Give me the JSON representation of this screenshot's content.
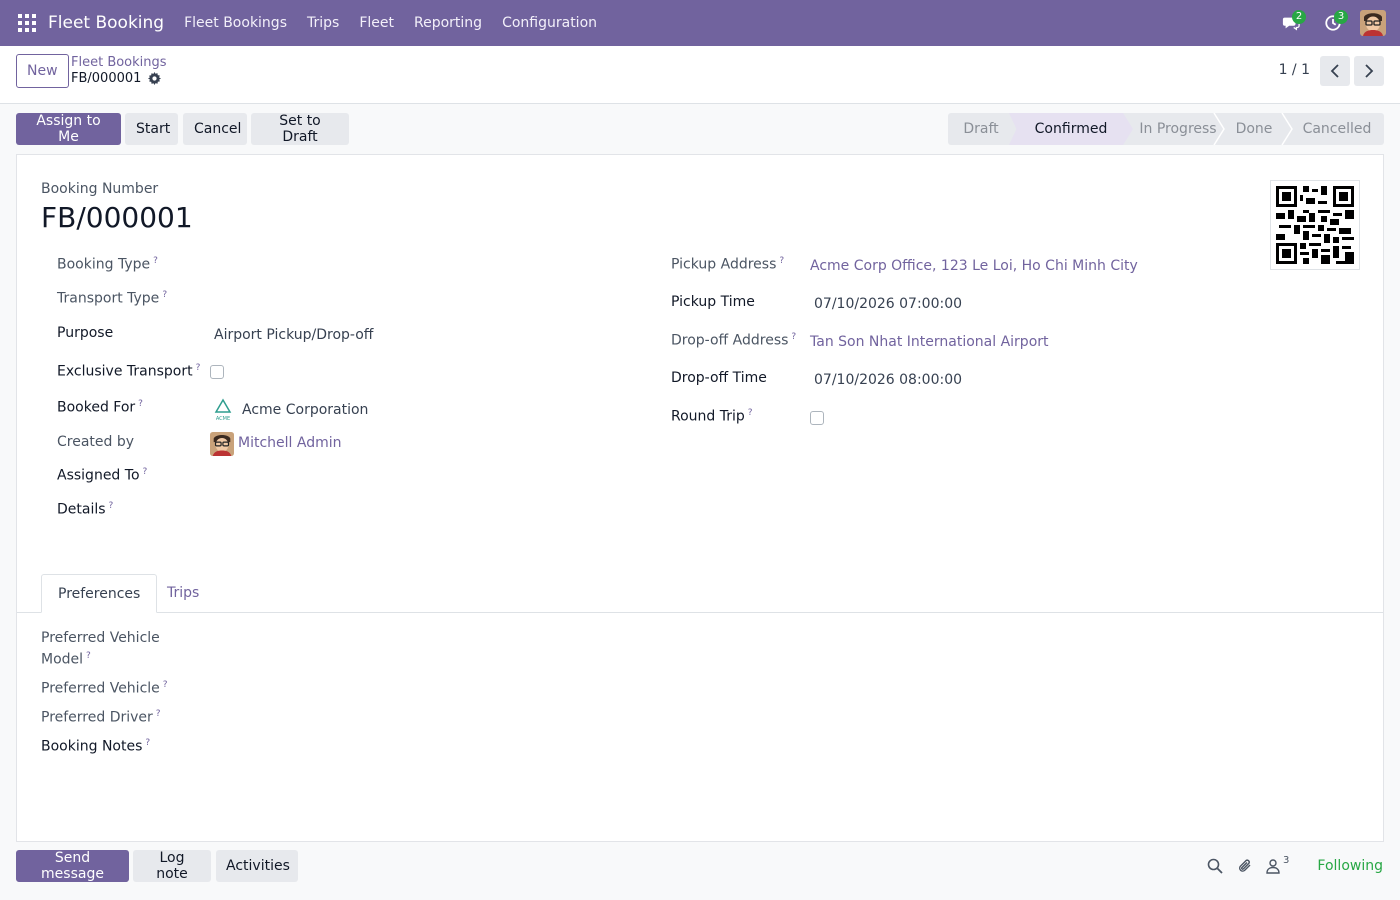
{
  "navbar": {
    "app_name": "Fleet Booking",
    "menus": [
      "Fleet Bookings",
      "Trips",
      "Fleet",
      "Reporting",
      "Configuration"
    ],
    "messages_count": "2",
    "activities_count": "3"
  },
  "control": {
    "new_label": "New",
    "breadcrumb_parent": "Fleet Bookings",
    "breadcrumb_current": "FB/000001",
    "pager": "1 / 1"
  },
  "status": {
    "buttons": [
      "Assign to Me",
      "Start",
      "Cancel",
      "Set to Draft"
    ],
    "stages": [
      "Draft",
      "Confirmed",
      "In Progress",
      "Done",
      "Cancelled"
    ],
    "active_stage": "Confirmed"
  },
  "form": {
    "booking_number_label": "Booking Number",
    "booking_number": "FB/000001",
    "left": {
      "booking_type_label": "Booking Type",
      "transport_type_label": "Transport Type",
      "purpose_label": "Purpose",
      "purpose_value": "Airport Pickup/Drop-off",
      "exclusive_label": "Exclusive Transport",
      "booked_for_label": "Booked For",
      "booked_for_value": "Acme Corporation",
      "created_by_label": "Created by",
      "created_by_value": "Mitchell Admin",
      "assigned_to_label": "Assigned To",
      "details_label": "Details"
    },
    "right": {
      "pickup_address_label": "Pickup Address",
      "pickup_address_value": "Acme Corp Office, 123 Le Loi, Ho Chi Minh City",
      "pickup_time_label": "Pickup Time",
      "pickup_time_value": "07/10/2026 07:00:00",
      "dropoff_address_label": "Drop-off Address",
      "dropoff_address_value": "Tan Son Nhat International Airport",
      "dropoff_time_label": "Drop-off Time",
      "dropoff_time_value": "07/10/2026 08:00:00",
      "round_trip_label": "Round Trip"
    },
    "help_mark": "?",
    "acme_logo_text": "ACME"
  },
  "tabs": {
    "items": [
      "Preferences",
      "Trips"
    ],
    "active": "Preferences",
    "preferences": {
      "vehicle_model_label_1": "Preferred Vehicle",
      "vehicle_model_label_2": "Model",
      "vehicle_label": "Preferred Vehicle",
      "driver_label": "Preferred Driver",
      "notes_label": "Booking Notes"
    }
  },
  "chatter": {
    "send_message": "Send message",
    "log_note": "Log note",
    "activities": "Activities",
    "followers_count": "3",
    "following": "Following"
  },
  "colors": {
    "brand": "#71639e",
    "success": "#28a745"
  }
}
